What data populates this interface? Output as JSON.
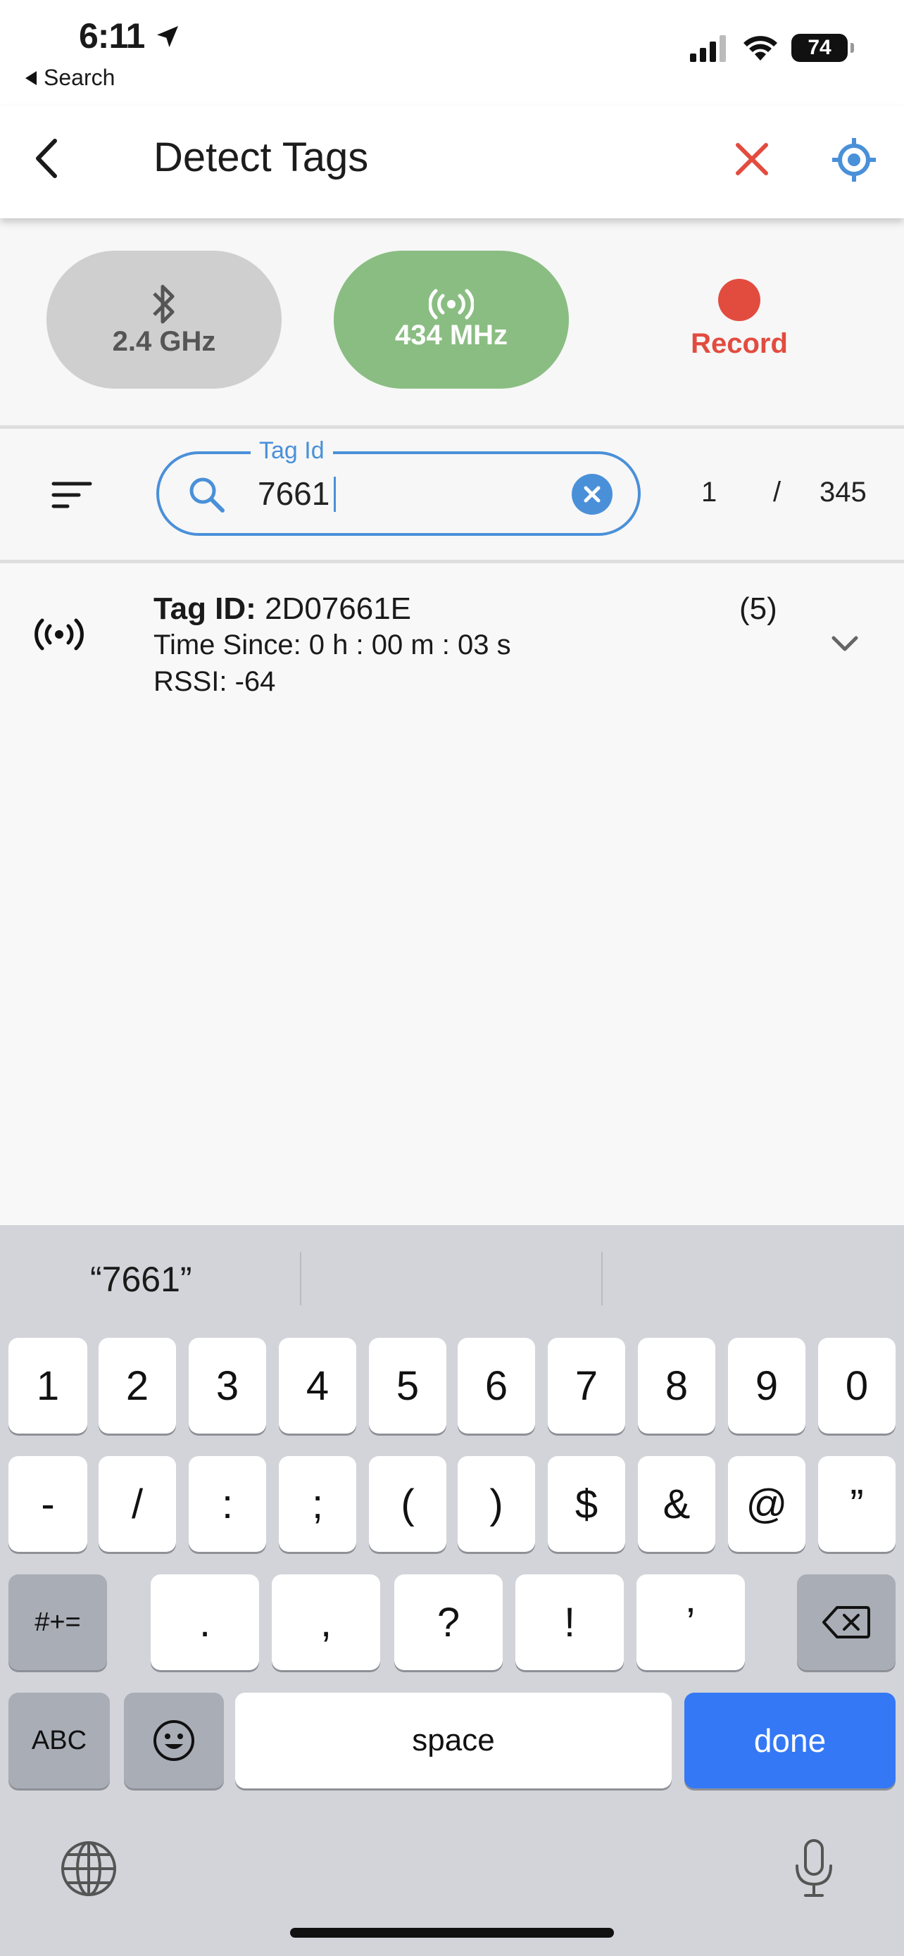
{
  "status_bar": {
    "time": "6:11",
    "back_app": "Search",
    "battery": "74"
  },
  "app_bar": {
    "title": "Detect Tags"
  },
  "modes": {
    "bluetooth_label": "2.4 GHz",
    "radio_label": "434 MHz",
    "record_label": "Record"
  },
  "search": {
    "label": "Tag Id",
    "value": "7661",
    "current": "1",
    "separator": "/",
    "total": "345"
  },
  "results": [
    {
      "tag_id_label": "Tag ID:",
      "tag_id": "2D07661E",
      "count": "(5)",
      "time_since": "Time Since: 0 h : 00 m : 03 s",
      "rssi": "RSSI: -64"
    }
  ],
  "keyboard": {
    "suggestion": "“7661”",
    "row1": [
      "1",
      "2",
      "3",
      "4",
      "5",
      "6",
      "7",
      "8",
      "9",
      "0"
    ],
    "row2": [
      "-",
      "/",
      ":",
      ";",
      "(",
      ")",
      "$",
      "&",
      "@",
      "”"
    ],
    "row3": [
      "#+=",
      ".",
      ",",
      "?",
      "!",
      "’"
    ],
    "abc": "ABC",
    "space": "space",
    "done": "done"
  },
  "colors": {
    "accent_blue": "#4a90d9",
    "record_red": "#e24c3f",
    "radio_green": "#8abd82",
    "done_blue": "#3478f6"
  }
}
